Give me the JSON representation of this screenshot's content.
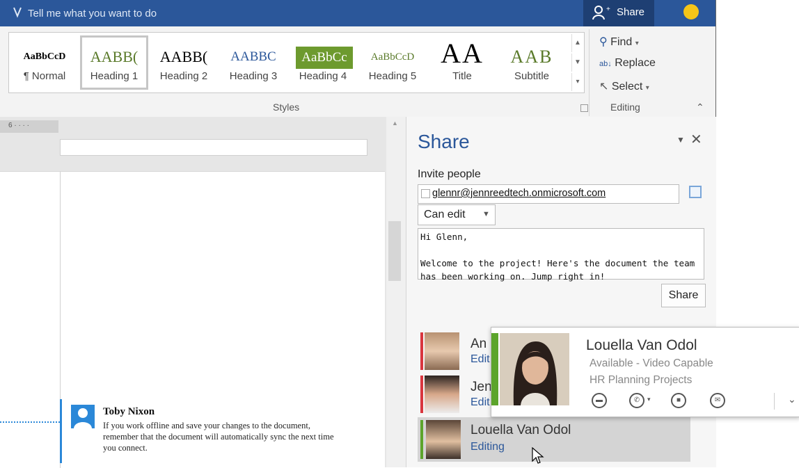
{
  "titlebar": {
    "tell_me": "Tell me what you want to do",
    "share_label": "Share"
  },
  "ribbon": {
    "styles": [
      {
        "preview": "AaBbCcD",
        "name": "¶ Normal",
        "color": "#000000"
      },
      {
        "preview": "AABB(",
        "name": "Heading 1",
        "color": "#5a7a2a"
      },
      {
        "preview": "AABB(",
        "name": "Heading 2",
        "color": "#000000"
      },
      {
        "preview": "AABBC",
        "name": "Heading 3",
        "color": "#2b579a"
      },
      {
        "preview": "AaBbCc",
        "name": "Heading 4",
        "color": "#ffffff"
      },
      {
        "preview": "AaBbCcD",
        "name": "Heading 5",
        "color": "#5a7a2a"
      },
      {
        "preview": "AA",
        "name": "Title",
        "color": "#000000"
      },
      {
        "preview": "AAB",
        "name": "Subtitle",
        "color": "#5a7a2a"
      }
    ],
    "styles_label": "Styles",
    "editing": {
      "find": "Find",
      "replace": "Replace",
      "select": "Select",
      "label": "Editing"
    }
  },
  "ruler": {
    "text": "6 · · · ·"
  },
  "comment": {
    "author": "Toby Nixon",
    "text": "If you work offline and save your changes to the document, remember that the document will automatically sync the next time you connect."
  },
  "share_pane": {
    "title": "Share",
    "invite_label": "Invite people",
    "email": "glennr@jennreedtech.onmicrosoft.com",
    "permission": "Can edit",
    "message": "Hi Glenn,\n\nWelcome to the project! Here's the document the team\nhas been working on. Jump right in!",
    "share_button": "Share",
    "people": [
      {
        "name": "An",
        "status": "Edit",
        "bar_color": "#d9363e"
      },
      {
        "name": "Jen",
        "status": "Edit",
        "bar_color": "#d9363e"
      },
      {
        "name": "Louella Van Odol",
        "status": "Editing",
        "bar_color": "#5ca42b"
      }
    ]
  },
  "contact_card": {
    "name": "Louella Van Odol",
    "status": "Available - Video Capable",
    "title": "HR Planning Projects"
  }
}
